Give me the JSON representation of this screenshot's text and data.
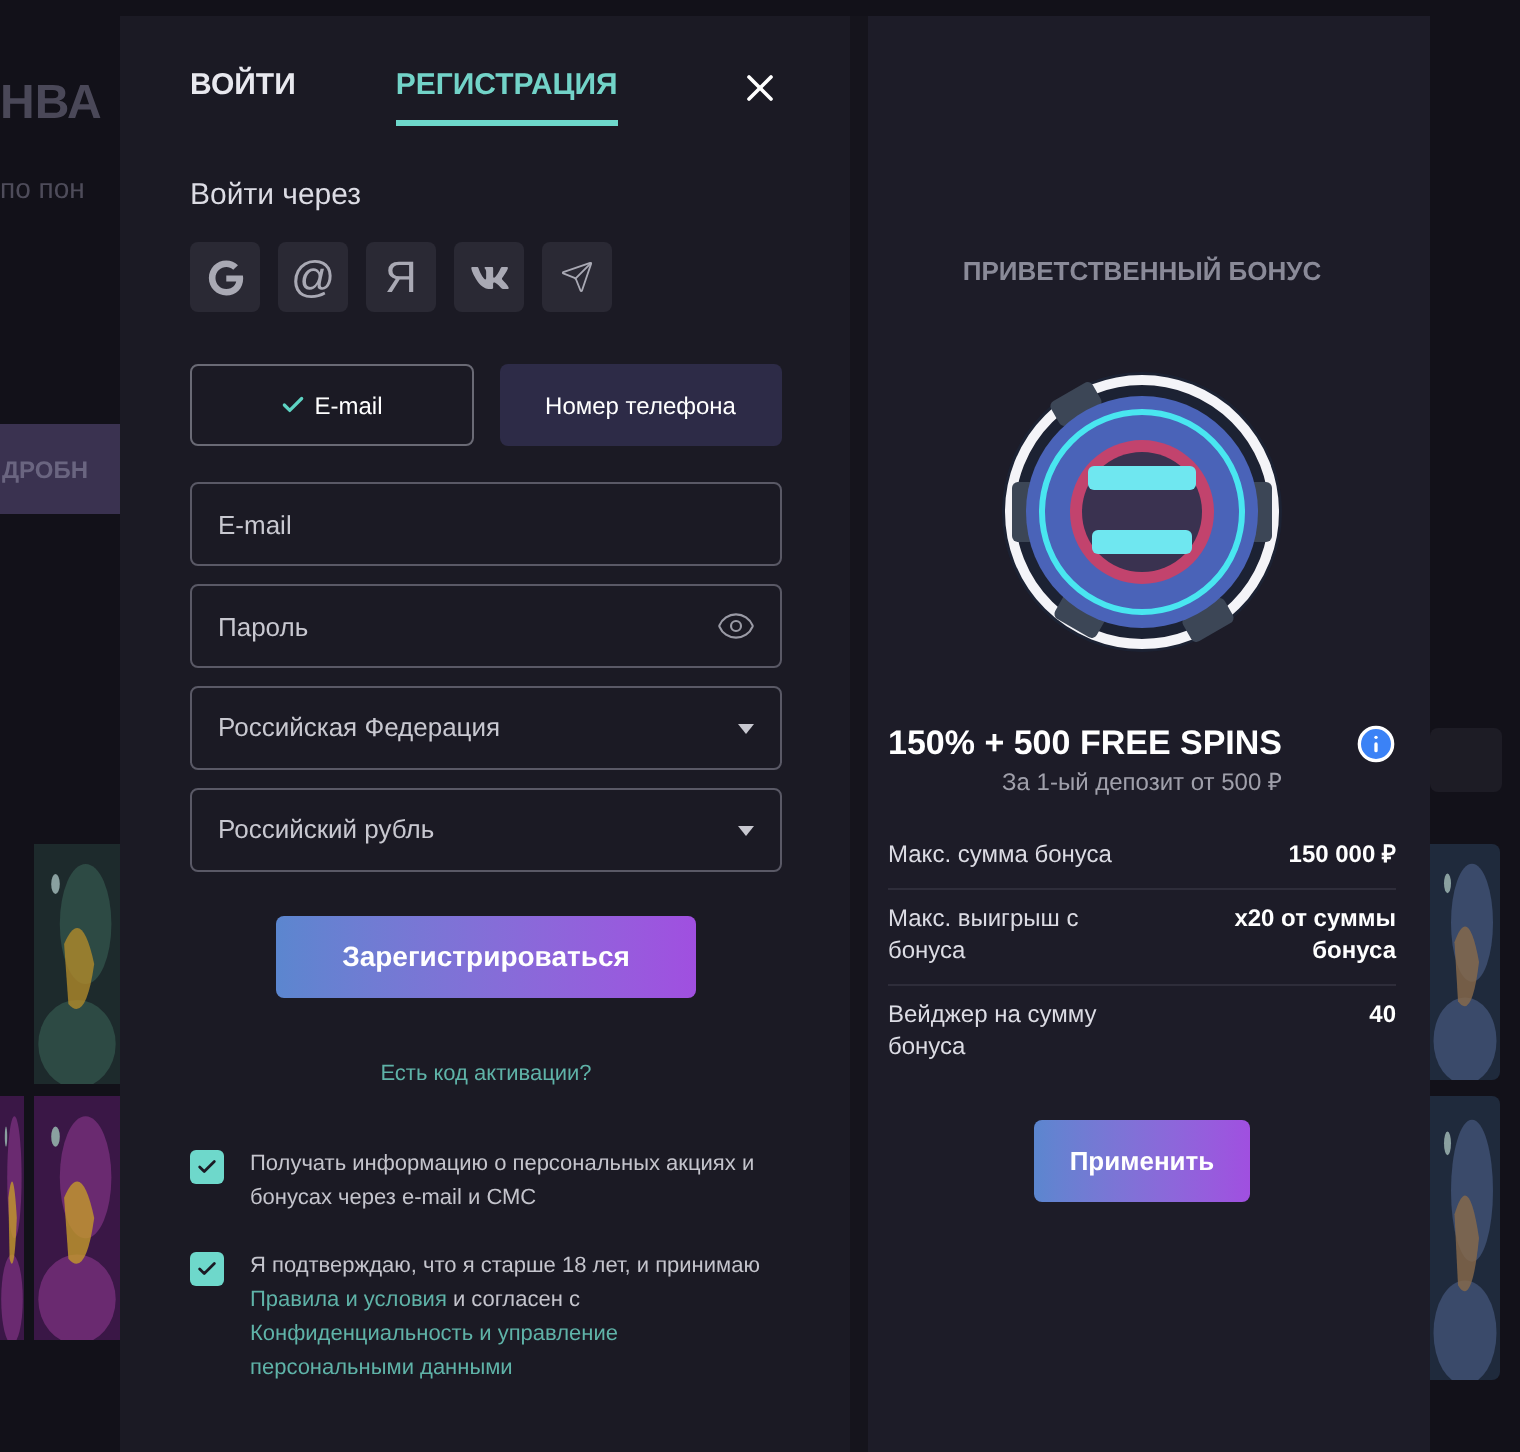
{
  "backdrop": {
    "heading": "НВА",
    "subtitle": "по пон",
    "button": "ДРОБН"
  },
  "tabs": [
    {
      "label": "ВОЙТИ",
      "selected": false
    },
    {
      "label": "РЕГИСТРАЦИЯ",
      "selected": true
    }
  ],
  "social_login": {
    "label": "Войти через",
    "providers": [
      {
        "kind": "google"
      },
      {
        "kind": "glyph",
        "glyph": "@"
      },
      {
        "kind": "glyph",
        "glyph": "Я"
      },
      {
        "kind": "vk"
      },
      {
        "kind": "telegram"
      }
    ]
  },
  "method_toggle": [
    {
      "label": "E-mail",
      "selected": true
    },
    {
      "label": "Номер телефона",
      "selected": false
    }
  ],
  "fields": [
    {
      "kind": "text",
      "placeholder": "E-mail"
    },
    {
      "kind": "password",
      "placeholder": "Пароль"
    },
    {
      "kind": "select",
      "value": "Российская Федерация"
    },
    {
      "kind": "select",
      "value": "Российский рубль"
    }
  ],
  "submit": "Зарегистрироваться",
  "promo_link": "Есть код активации?",
  "consents": [
    {
      "checked": true,
      "parts": [
        {
          "kind": "text",
          "text": "Получать информацию о персональных акциях и бонусах через e-mail и СМС"
        }
      ]
    },
    {
      "checked": true,
      "parts": [
        {
          "kind": "text",
          "text": "Я подтверждаю, что я старше 18 лет, и принимаю "
        },
        {
          "kind": "link",
          "text": "Правила и условия"
        },
        {
          "kind": "text",
          "text": " и согласен с "
        },
        {
          "kind": "link",
          "text": "Конфиденциальность и управление"
        },
        {
          "kind": "space"
        },
        {
          "kind": "link",
          "text": "персональными данными"
        }
      ]
    }
  ],
  "bonus": {
    "heading": "ПРИВЕТСТВЕННЫЙ БОНУС",
    "title": "150% + 500 FREE SPINS",
    "subtitle": "За 1-ый депозит от 500 ₽",
    "details": [
      {
        "label": "Макс. сумма бонуса",
        "value": "150 000 ₽"
      },
      {
        "label": "Макс. выигрыш с бонуса",
        "value": "x20 от суммы бонуса"
      },
      {
        "label": "Вейджер на сумму бонуса",
        "value": "40"
      }
    ],
    "button": "Применить"
  }
}
